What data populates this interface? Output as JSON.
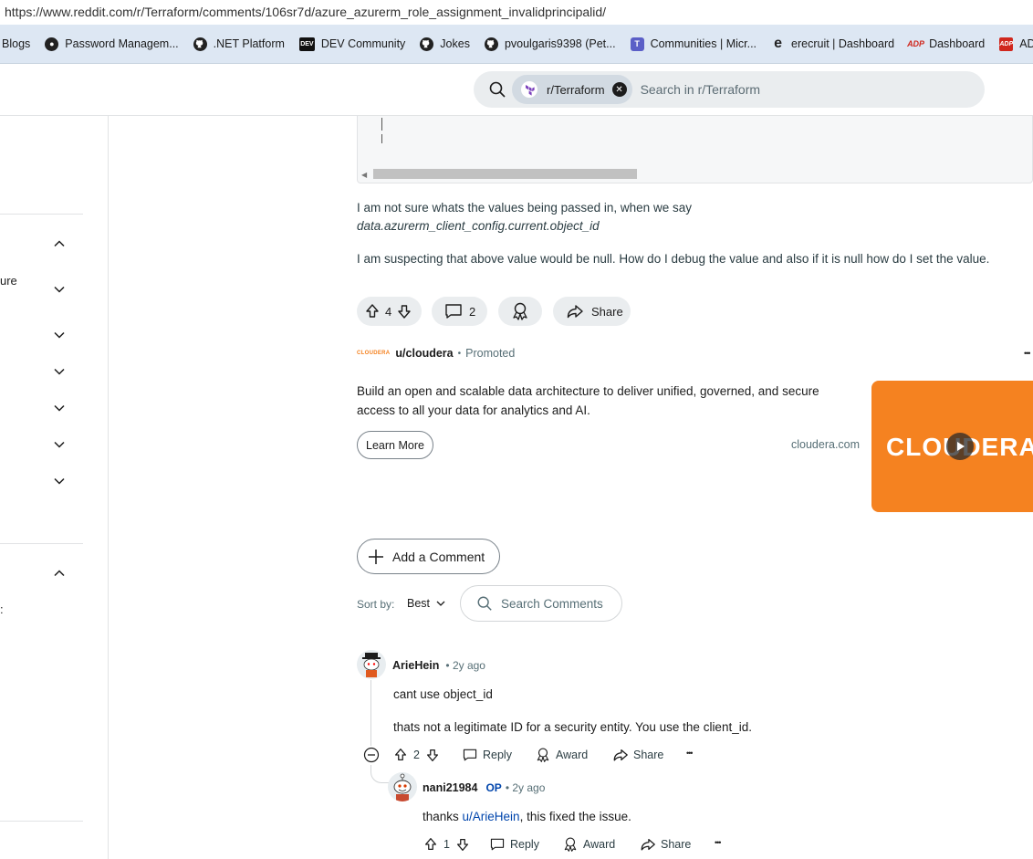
{
  "browser": {
    "url": "https://www.reddit.com/r/Terraform/comments/106sr7d/azure_azurerm_role_assignment_invalidprincipalid/",
    "bookmarks": [
      "Blogs",
      "Password Managem...",
      ".NET Platform",
      "DEV Community",
      "Jokes",
      "pvoulgaris9398 (Pet...",
      "Communities | Micr...",
      "erecruit | Dashboard",
      "Dashboard",
      "ADP Workf"
    ],
    "bookmark_icons": [
      "",
      "password-icon",
      "github-icon",
      "dev-icon",
      "github-icon",
      "github-icon",
      "teams-icon",
      "edge-icon",
      "adp-icon",
      "adp-icon"
    ]
  },
  "header": {
    "subreddit_chip": "r/Terraform",
    "search_placeholder": "Search in r/Terraform"
  },
  "sidebar": {
    "partial_text_1": "ure",
    "partial_text_2": ":"
  },
  "post": {
    "paragraph1_line1": "I am not sure whats the values being passed in, when we say",
    "paragraph1_line2": "data.azurerm_client_config.current.object_id",
    "paragraph2": "I am suspecting that above value would be null. How do I debug the value and also if it is null how do I set the value.",
    "votes": "4",
    "comments": "2",
    "share": "Share"
  },
  "promo": {
    "logo_text": "CLOUDERA",
    "user": "u/cloudera",
    "dot": "•",
    "label": "Promoted",
    "more": "•••",
    "body_line1": "Build an open and scalable data architecture to deliver unified, governed, and secure",
    "body_line2": "access to all your data for analytics and AI.",
    "cta": "Learn More",
    "domain": "cloudera.com",
    "image_text": "CLOUDERA"
  },
  "comments_section": {
    "add_comment": "Add a Comment",
    "sort_label": "Sort by:",
    "sort_value": "Best",
    "search_placeholder": "Search Comments"
  },
  "comments": [
    {
      "author": "ArieHein",
      "time": "• 2y ago",
      "line1": "cant use object_id",
      "line2": "thats not a legitimate ID for a security entity. You use the client_id.",
      "votes": "2",
      "reply": "Reply",
      "award": "Award",
      "share": "Share",
      "more": "•••"
    },
    {
      "author": "nani21984",
      "op": "OP",
      "time": "• 2y ago",
      "text_prefix": "thanks ",
      "mention": "u/ArieHein",
      "text_suffix": ", this fixed the issue.",
      "votes": "1",
      "reply": "Reply",
      "award": "Award",
      "share": "Share",
      "more": "•••"
    }
  ],
  "colors": {
    "brand_orange": "#f58220",
    "link_blue": "#0045ac",
    "chip_bg": "#d2dae2",
    "button_bg": "#eaedef"
  }
}
